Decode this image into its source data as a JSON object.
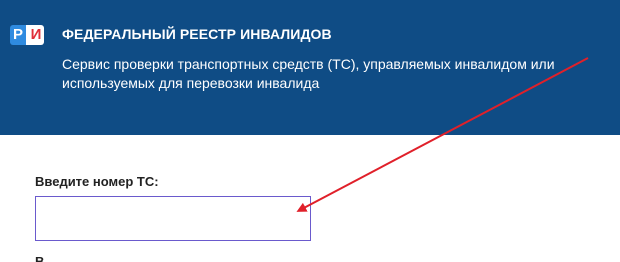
{
  "header": {
    "logo": {
      "letter_left": "Р",
      "letter_right": "И",
      "colors": {
        "left_bg": "#2f8be0",
        "right_fg": "#e0303a"
      }
    },
    "title": "ФЕДЕРАЛЬНЫЙ РЕЕСТР ИНВАЛИДОВ",
    "subtitle": "Сервис проверки транспортных средств (ТС), управляемых инвалидом или используемых для перевозки инвалида",
    "background_color": "#0f4c85"
  },
  "form": {
    "vehicle_number_label": "Введите номер ТС:",
    "vehicle_number_value": "",
    "next_label": "В"
  },
  "annotation": {
    "arrow_color": "#e0202a"
  }
}
